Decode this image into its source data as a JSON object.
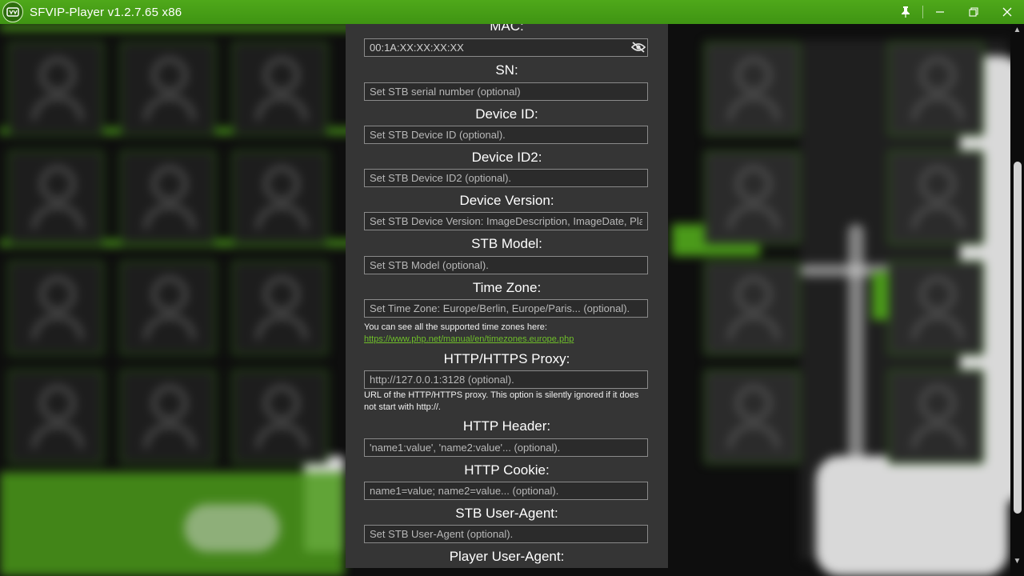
{
  "window": {
    "title": "SFVIP-Player v1.2.7.65 x86",
    "icons": [
      "app-logo-icon",
      "pin-icon",
      "minimize-icon",
      "maximize-icon",
      "close-icon"
    ]
  },
  "settings": {
    "mac": {
      "label": "MAC:",
      "value": "00:1A:XX:XX:XX:XX",
      "icon": "eye-slash-icon"
    },
    "sn": {
      "label": "SN:",
      "placeholder": "Set STB serial number (optional)"
    },
    "device_id": {
      "label": "Device ID:",
      "placeholder": "Set STB Device ID (optional)."
    },
    "device_id2": {
      "label": "Device ID2:",
      "placeholder": "Set STB Device ID2 (optional)."
    },
    "device_version": {
      "label": "Device Version:",
      "placeholder": "Set STB Device Version: ImageDescription, ImageDate, PlayerVersion... (optional)."
    },
    "stb_model": {
      "label": "STB Model:",
      "placeholder": "Set STB Model (optional)."
    },
    "time_zone": {
      "label": "Time Zone:",
      "placeholder": "Set Time Zone: Europe/Berlin, Europe/Paris... (optional).",
      "help": "You can see all the supported time zones here:",
      "link": "https://www.php.net/manual/en/timezones.europe.php"
    },
    "proxy": {
      "label": "HTTP/HTTPS Proxy:",
      "placeholder": "http://127.0.0.1:3128 (optional).",
      "help": "URL of the HTTP/HTTPS proxy. This option is silently ignored if it does not start with http://."
    },
    "http_header": {
      "label": "HTTP Header:",
      "placeholder": "'name1:value', 'name2:value'... (optional)."
    },
    "http_cookie": {
      "label": "HTTP Cookie:",
      "placeholder": "name1=value; name2=value... (optional)."
    },
    "stb_user_agent": {
      "label": "STB User-Agent:",
      "placeholder": "Set STB User-Agent (optional)."
    },
    "player_user_agent": {
      "label": "Player User-Agent:"
    }
  },
  "colors": {
    "titlebar": "#4fa81a",
    "dialog_bg": "#353535",
    "link": "#6fbf2a"
  }
}
